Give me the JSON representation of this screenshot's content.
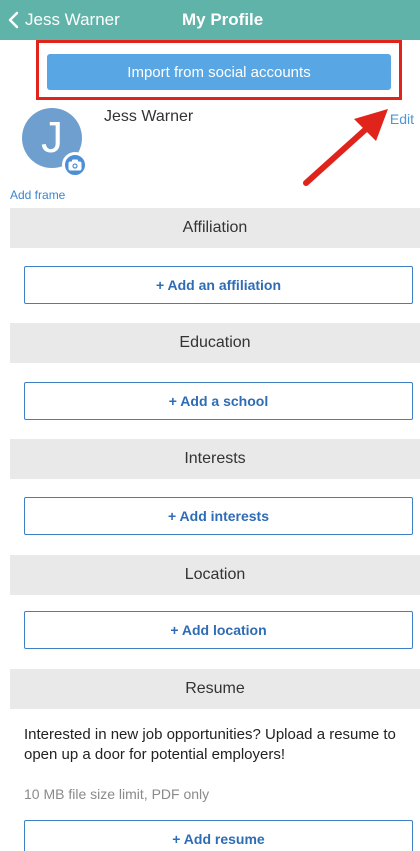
{
  "topbar": {
    "back_label": "Jess Warner",
    "title": "My Profile"
  },
  "import_button": {
    "label": "Import from social accounts"
  },
  "profile": {
    "avatar_initial": "J",
    "name": "Jess Warner",
    "edit_label": "Edit",
    "add_frame_label": "Add frame"
  },
  "sections": [
    {
      "header": "Affiliation",
      "button": "+ Add an affiliation"
    },
    {
      "header": "Education",
      "button": "+ Add a school"
    },
    {
      "header": "Interests",
      "button": "+ Add interests"
    },
    {
      "header": "Location",
      "button": "+ Add location"
    },
    {
      "header": "Resume",
      "button": "+ Add resume"
    }
  ],
  "resume": {
    "description": "Interested in new job opportunities? Upload a resume to open up a door for potential employers!",
    "limit": "10 MB file size limit, PDF only"
  },
  "colors": {
    "topbar": "#5fb3a8",
    "import_button": "#58a6e4",
    "highlight": "#e0231b",
    "link": "#4d96d9",
    "section_bg": "#e9e9e9",
    "add_button_text": "#2e6cb5"
  },
  "icons": {
    "back": "chevron-left-icon",
    "camera": "camera-icon",
    "annotation": "red-arrow-icon"
  }
}
